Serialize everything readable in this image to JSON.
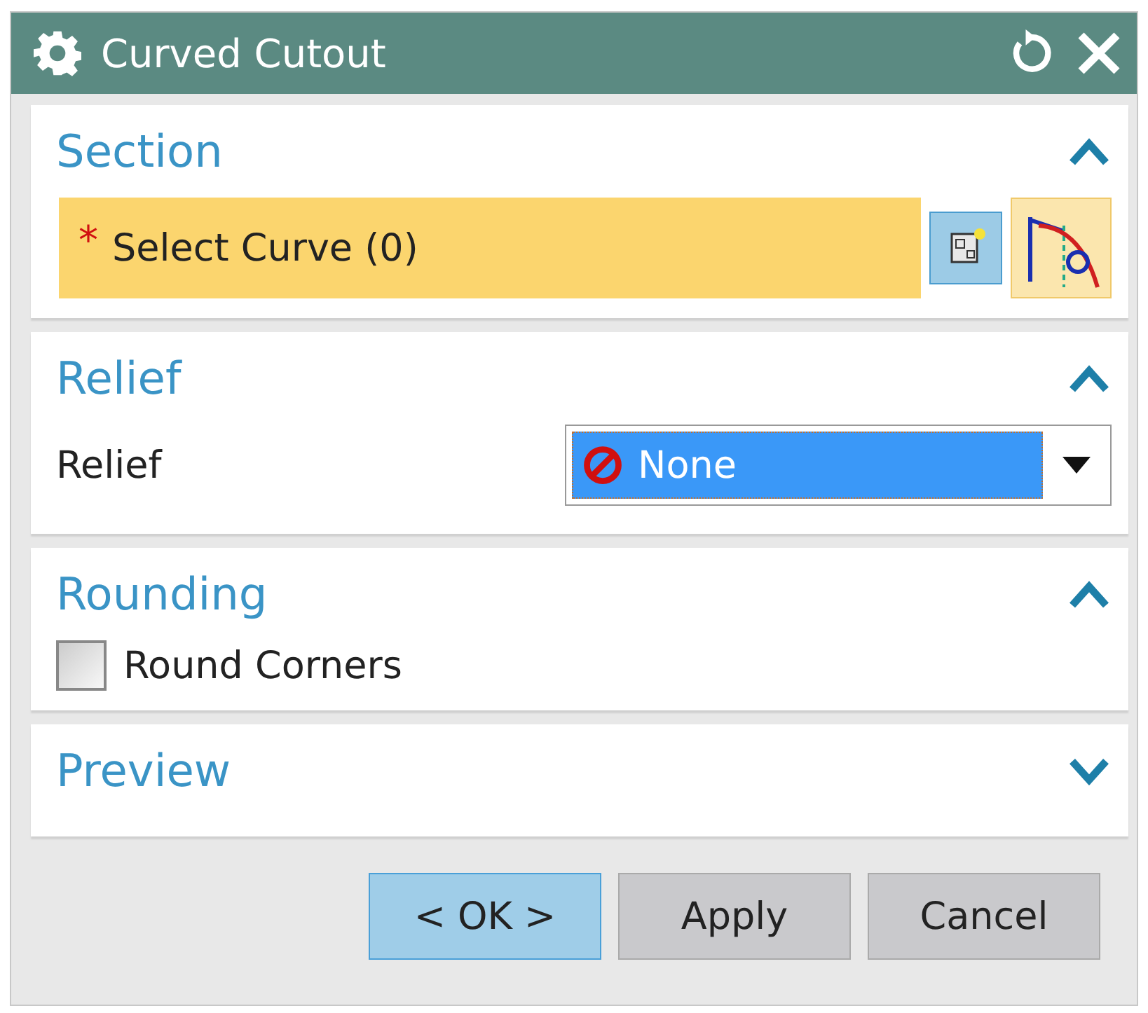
{
  "window": {
    "title": "Curved Cutout"
  },
  "groups": [
    {
      "title": "Section",
      "expanded": true,
      "kind": "selection",
      "required_mark": "*",
      "label": "Select Curve (0)"
    },
    {
      "title": "Relief",
      "expanded": true,
      "kind": "dropdown",
      "label": "Relief",
      "value": "None"
    },
    {
      "title": "Rounding",
      "expanded": true,
      "kind": "checkbox",
      "label": "Round Corners",
      "checked": false
    },
    {
      "title": "Preview",
      "expanded": false
    }
  ],
  "buttons": [
    {
      "label": "< OK >",
      "selected": true
    },
    {
      "label": "Apply",
      "selected": false
    },
    {
      "label": "Cancel",
      "selected": false
    }
  ]
}
